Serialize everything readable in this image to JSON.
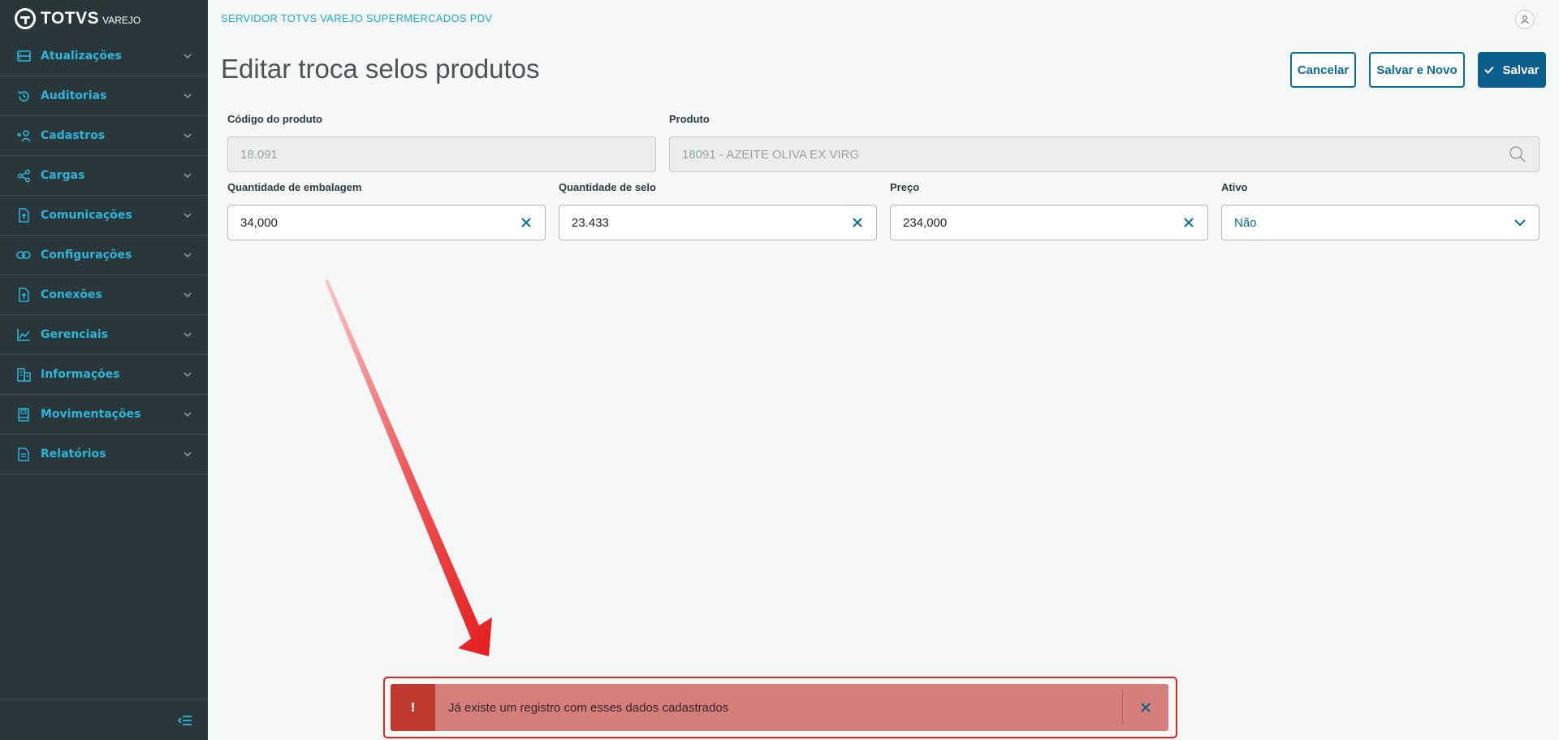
{
  "brand": {
    "name": "TOTVS",
    "sub": "VAREJO"
  },
  "sidebar": {
    "items": [
      {
        "label": "Atualizações",
        "icon": "server-icon"
      },
      {
        "label": "Auditorias",
        "icon": "history-icon"
      },
      {
        "label": "Cadastros",
        "icon": "add-user-icon"
      },
      {
        "label": "Cargas",
        "icon": "share-icon"
      },
      {
        "label": "Comunicações",
        "icon": "file-exchange-icon"
      },
      {
        "label": "Configurações",
        "icon": "link-icon"
      },
      {
        "label": "Conexões",
        "icon": "file-upload-icon"
      },
      {
        "label": "Gerenciais",
        "icon": "chart-icon"
      },
      {
        "label": "Informações",
        "icon": "building-icon"
      },
      {
        "label": "Movimentações",
        "icon": "book-icon"
      },
      {
        "label": "Relatórios",
        "icon": "document-icon"
      }
    ]
  },
  "header": {
    "server_title": "SERVIDOR TOTVS VAREJO SUPERMERCADOS PDV"
  },
  "page": {
    "title": "Editar troca selos produtos",
    "buttons": {
      "cancel": "Cancelar",
      "save_new": "Salvar e Novo",
      "save": "Salvar"
    }
  },
  "form": {
    "codigo": {
      "label": "Código do produto",
      "value": "18.091"
    },
    "produto": {
      "label": "Produto",
      "value": "18091 - AZEITE OLIVA EX VIRG"
    },
    "qtd_embalagem": {
      "label": "Quantidade de embalagem",
      "value": "34,000"
    },
    "qtd_selo": {
      "label": "Quantidade de selo",
      "value": "23.433"
    },
    "preco": {
      "label": "Preço",
      "value": "234,000"
    },
    "ativo": {
      "label": "Ativo",
      "value": "Não"
    }
  },
  "toast": {
    "icon": "!",
    "message": "Já existe um registro com esses dados cadastrados"
  },
  "colors": {
    "sidebar": "#29373a",
    "accent": "#2cb5d9",
    "primary": "#0c5f8c",
    "error": "#c0392f",
    "toast_bg": "#d57f7c",
    "highlight": "#e42321"
  }
}
